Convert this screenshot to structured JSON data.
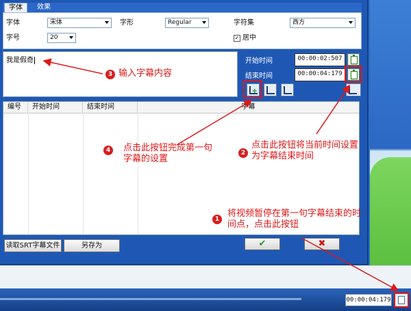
{
  "tabs": [
    "字体",
    "效果"
  ],
  "font": {
    "font_label": "字体",
    "font_value": "宋体",
    "style_label": "字形",
    "style_value": "Regular",
    "charset_label": "字符集",
    "charset_value": "西方",
    "size_label": "字号",
    "size_value": "20",
    "center_label": "居中",
    "center_checked": true
  },
  "subtitle_text": "我是假奇",
  "timing": {
    "start_label": "开始时间",
    "start_value": "00:00:02:507",
    "end_label": "结束时间",
    "end_value": "00:00:04:179"
  },
  "table": {
    "columns": [
      "编号",
      "开始时间",
      "结束时间",
      "字幕"
    ]
  },
  "buttons": {
    "read_srt": "读取SRT字幕文件",
    "save_as": "另存为",
    "ok": "✔",
    "cancel": "✖"
  },
  "player": {
    "time": "00:00:04:179"
  },
  "annotations": [
    {
      "num": "1",
      "text": "将视频暂停在第一句字幕结束的时间点，点击此按钮"
    },
    {
      "num": "2",
      "text": "点击此按钮将当前时间设置为字幕结束时间"
    },
    {
      "num": "3",
      "text": "输入字幕内容"
    },
    {
      "num": "4",
      "text": "点击此按钮完成第一句字幕的设置"
    }
  ],
  "colors": {
    "accent": "#e01818",
    "dialog": "#1f58b4"
  }
}
